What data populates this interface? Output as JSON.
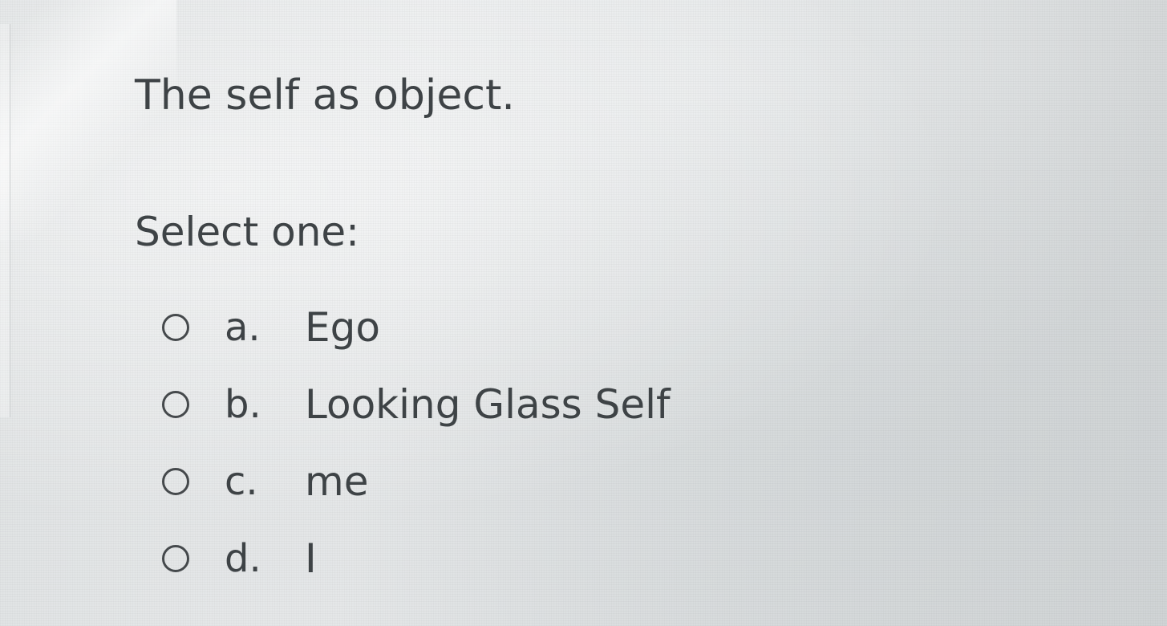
{
  "question": {
    "text": "The self as object.",
    "prompt": "Select one:"
  },
  "options": [
    {
      "letter": "a.",
      "label": "Ego",
      "selected": false
    },
    {
      "letter": "b.",
      "label": "Looking Glass Self",
      "selected": false
    },
    {
      "letter": "c.",
      "label": "me",
      "selected": false
    },
    {
      "letter": "d.",
      "label": "I",
      "selected": false
    }
  ],
  "colors": {
    "text": "#3e4346",
    "background": "#e2e5e6"
  }
}
